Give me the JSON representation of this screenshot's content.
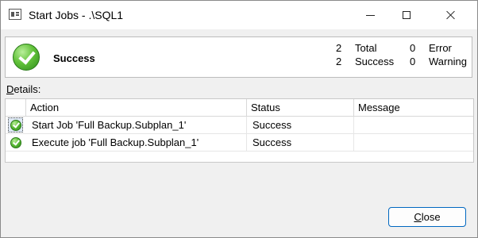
{
  "window": {
    "title": "Start Jobs - .\\SQL1"
  },
  "summary": {
    "status": "Success",
    "total_count": "2",
    "total_label": "Total",
    "success_count": "2",
    "success_label": "Success",
    "error_count": "0",
    "error_label": "Error",
    "warning_count": "0",
    "warning_label": "Warning"
  },
  "details": {
    "label_access_key": "D",
    "label_rest": "etails:"
  },
  "table": {
    "columns": [
      "Action",
      "Status",
      "Message"
    ],
    "rows": [
      {
        "action": "Start Job 'Full Backup.Subplan_1'",
        "status": "Success",
        "message": "",
        "icon": "success-check-icon"
      },
      {
        "action": "Execute job 'Full Backup.Subplan_1'",
        "status": "Success",
        "message": "",
        "icon": "success-check-icon"
      }
    ]
  },
  "buttons": {
    "close_access_key": "C",
    "close_rest": "lose"
  },
  "colors": {
    "success_green": "#4caf2a",
    "button_border": "#0067c0"
  }
}
